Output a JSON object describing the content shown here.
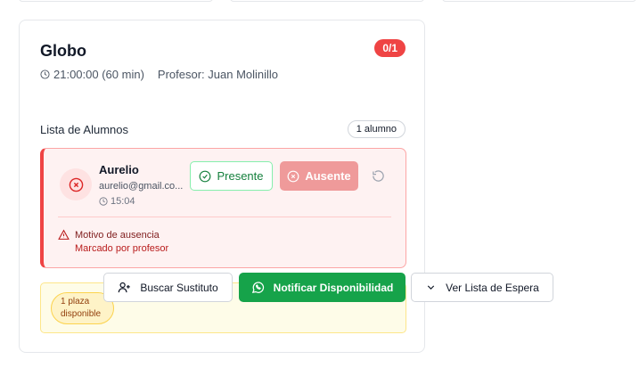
{
  "class_card": {
    "title": "Globo",
    "count_badge": "0/1",
    "time": "21:00:00 (60 min)",
    "teacher": "Profesor: Juan Molinillo"
  },
  "student_list": {
    "header": "Lista de Alumnos",
    "count_label": "1 alumno",
    "students": [
      {
        "name": "Aurelio",
        "email": "aurelio@gmail.co...",
        "time": "15:04",
        "present_label": "Presente",
        "absent_label": "Ausente",
        "absence_title": "Motivo de ausencia",
        "absence_reason": "Marcado por profesor"
      }
    ]
  },
  "actions": {
    "plaza_line1": "1 plaza",
    "plaza_line2": "disponible",
    "find_substitute": "Buscar Sustituto",
    "notify": "Notificar Disponibilidad",
    "waitlist": "Ver Lista de Espera"
  },
  "colors": {
    "danger": "#ef4444",
    "success": "#16a34a",
    "warning_bg": "#fefce8"
  },
  "icons": [
    "clock-icon",
    "x-circle-icon",
    "check-circle-icon",
    "reset-icon",
    "alert-triangle-icon",
    "user-plus-icon",
    "whatsapp-icon",
    "chevron-down-icon"
  ]
}
